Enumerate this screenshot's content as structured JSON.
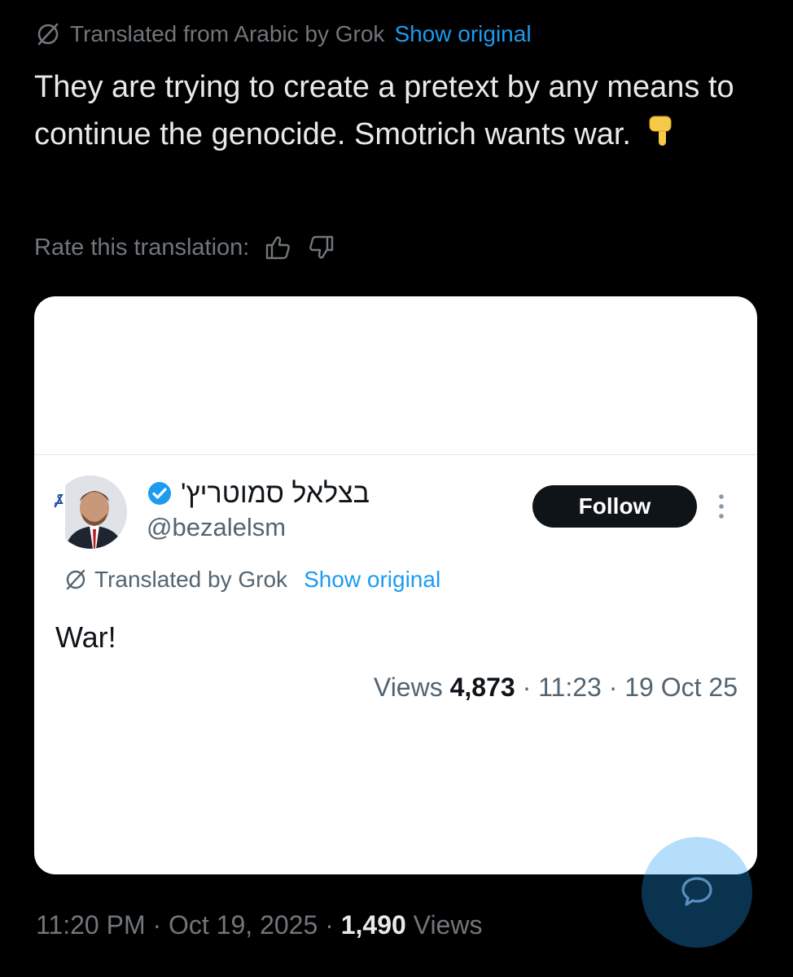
{
  "translation_bar": {
    "text": "Translated from Arabic by Grok",
    "show_original": "Show original"
  },
  "post": {
    "text": "They are trying to create a pretext by any means to continue the genocide. Smotrich wants war.",
    "emoji": "👇",
    "rate_label": "Rate this translation:"
  },
  "quoted": {
    "display_name": "בצלאל סמוטריץ'",
    "handle": "@bezalelsm",
    "follow_label": "Follow",
    "translation_text": "Translated by Grok",
    "show_original": "Show original",
    "text": "War!",
    "views_label": "Views",
    "views_count": "4,873",
    "sep1": "·",
    "time": "11:23",
    "sep2": "·",
    "date": "19 Oct 25"
  },
  "footer": {
    "time": "11:20 PM",
    "sep1": "·",
    "date": "Oct 19, 2025",
    "sep2": "·",
    "views_count": "1,490",
    "views_label": "Views"
  },
  "icons": {
    "grok": "grok-icon",
    "thumbs_up": "thumbs-up-icon",
    "thumbs_down": "thumbs-down-icon",
    "verified": "verified-badge-icon",
    "more": "more-vertical-icon",
    "fab": "chat-bubble-icon"
  },
  "colors": {
    "background": "#000000",
    "link": "#1d9bf0",
    "muted": "#71767b",
    "card": "#ffffff",
    "follow_button": "#0f1419"
  }
}
